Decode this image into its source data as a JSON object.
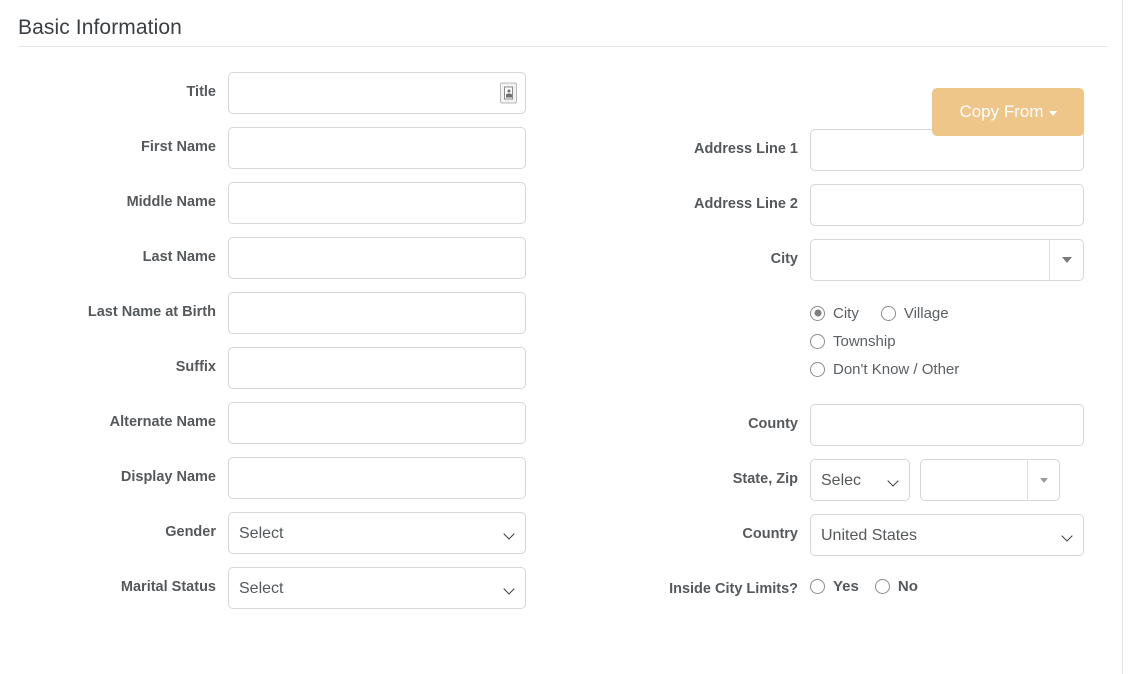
{
  "section": {
    "title": "Basic Information"
  },
  "copy_from": {
    "label": "Copy From",
    "caret_icon": "caret-down-icon",
    "bg_color": "#eec68a",
    "text_color": "#ffffff"
  },
  "left_column": {
    "fields": [
      {
        "label": "Title",
        "type": "text-with-icon",
        "value": "",
        "placeholder": "",
        "icon": "contact-card-icon"
      },
      {
        "label": "First Name",
        "type": "text",
        "value": "",
        "placeholder": ""
      },
      {
        "label": "Middle Name",
        "type": "text",
        "value": "",
        "placeholder": ""
      },
      {
        "label": "Last Name",
        "type": "text",
        "value": "",
        "placeholder": ""
      },
      {
        "label": "Last Name at Birth",
        "type": "text",
        "value": "",
        "placeholder": ""
      },
      {
        "label": "Suffix",
        "type": "text",
        "value": "",
        "placeholder": ""
      },
      {
        "label": "Alternate Name",
        "type": "text",
        "value": "",
        "placeholder": ""
      },
      {
        "label": "Display Name",
        "type": "text",
        "value": "",
        "placeholder": ""
      },
      {
        "label": "Gender",
        "type": "select",
        "value": "Select",
        "options": [
          "Select"
        ]
      },
      {
        "label": "Marital Status",
        "type": "select",
        "value": "Select",
        "options": [
          "Select"
        ]
      }
    ]
  },
  "right_column": {
    "fields": [
      {
        "label": "Address Line 1",
        "type": "text",
        "value": "",
        "placeholder": ""
      },
      {
        "label": "Address Line 2",
        "type": "text",
        "value": "",
        "placeholder": ""
      },
      {
        "label": "City",
        "type": "combo",
        "value": "",
        "placeholder": "",
        "dropdown_icon": "triangle-down-icon"
      },
      {
        "label": "County",
        "type": "text",
        "value": "",
        "placeholder": ""
      }
    ],
    "place_type_radios": {
      "selected": "City",
      "options": [
        "City",
        "Village",
        "Township",
        "Don't Know / Other"
      ]
    },
    "state_zip": {
      "label": "State, Zip",
      "state": {
        "value": "Selec",
        "options": [
          "Selec"
        ]
      },
      "zip": {
        "value": "",
        "placeholder": "",
        "dropdown_icon": "triangle-down-icon"
      }
    },
    "country": {
      "label": "Country",
      "value": "United States",
      "options": [
        "United States"
      ]
    },
    "inside_city_limits": {
      "label": "Inside City Limits?",
      "selected": "",
      "options": [
        "Yes",
        "No"
      ]
    }
  }
}
